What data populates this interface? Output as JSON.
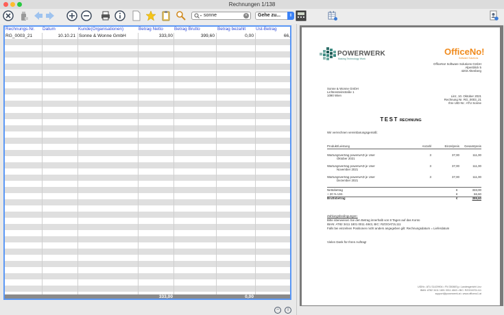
{
  "window": {
    "title": "Rechnungen 1/138"
  },
  "toolbar": {
    "search_value": "sonne",
    "goto_label": "Gehe zu...",
    "icons": [
      "close-record-icon",
      "bottle-icon",
      "arrow-left-icon",
      "arrow-right-icon",
      "add-icon",
      "remove-icon",
      "print-icon",
      "info-icon",
      "new-document-icon",
      "star-icon",
      "clipboard-icon",
      "magnifier-icon",
      "search-icon",
      "calculator-icon",
      "table-settings-icon",
      "user-settings-icon"
    ]
  },
  "table": {
    "columns": [
      "Rechnungs-Nr.",
      "Datum",
      "Kunde(Organisationen)",
      "Betrag Netto",
      "Betrag Brutto",
      "Betrag bezahlt",
      "Ust-Betrag"
    ],
    "rows": [
      {
        "nr": "RG_0003_21",
        "datum": "10.10.21",
        "kunde": "Sonne & Wonne GmbH",
        "netto": "333,00",
        "brutto": "399,60",
        "bezahlt": "0,00",
        "ust": "66,"
      }
    ],
    "footer": {
      "netto": "333,00",
      "bezahlt": "0,00"
    }
  },
  "invoice": {
    "brand_left": "POWERWERK",
    "brand_left_sub": "Making Technology Work",
    "brand_right": "OfficeNo!",
    "brand_right_sub": "Software Solutions",
    "sender_lines": [
      "OfficeNo! Software Solutions GmbH",
      "Alpenblick 5",
      "4203 Altenberg"
    ],
    "recipient_lines": [
      "Sonne & Wonne GmbH",
      "Lichtensteinstraße 1",
      "1090 Wien"
    ],
    "meta_lines": [
      "Linz, 10. Oktober 2021",
      "Rechnung Nr. RG_0003_21",
      "Ihre UID-Nr.: ATU Sonne"
    ],
    "title_test": "TEST",
    "title_rest": "RECHNUNG",
    "intro": "Wir verrechnen vereinbarungsgemäß:",
    "table_headers": [
      "Produkt/Leistung",
      "Anzahl",
      "Einzelpreis",
      "Gesamtpreis"
    ],
    "items": [
      {
        "line1": "Wartungsvertrag powerwAD je User",
        "line2": "Oktober 2021",
        "qty": "3",
        "unit": "37,00",
        "total": "111,00"
      },
      {
        "line1": "Wartungsvertrag powerwAD je User",
        "line2": "November 2021",
        "qty": "3",
        "unit": "37,00",
        "total": "111,00"
      },
      {
        "line1": "Wartungsvertrag powerwAD je User",
        "line2": "Dezember 2021",
        "qty": "3",
        "unit": "37,00",
        "total": "111,00"
      }
    ],
    "totals": [
      {
        "label": "Nettobetrag",
        "cur": "€",
        "value": "333,00",
        "bold": false
      },
      {
        "label": "+ 20 % USt.",
        "cur": "€",
        "value": "66,60",
        "bold": false
      },
      {
        "label": "Bruttobetrag",
        "cur": "€",
        "value": "399,60",
        "bold": true
      }
    ],
    "terms_heading": "Zahlungsbedingungen:",
    "terms_lines": [
      "Bitte überweisen Sie den Betrag innerhalb von 8 Tagen auf das Konto",
      "IBAN: AT82 3411 1801 0011 4843, BIC: RZOOAT2L111",
      "Falls bei einzelnen Positionen nicht anders angegeben gilt: Rechnungsdatum = Lieferdatum"
    ],
    "thanks": "Vielen Dank für Ihren Auftrag!",
    "footer_lines": [
      "UIDNr.: ATU 31429904 • FN 350887g • Landesgericht Linz",
      "IBAN: AT82 3411 1801 0011 4843 • BIC: RZOOAT2L111",
      "support@powerwerk.at • www.officeno1.at"
    ]
  },
  "colors": {
    "accent": "#5a97f5",
    "header_text": "#2a46d6",
    "alt_row": "#dfdfdf",
    "footer": "#8a8a8a"
  }
}
